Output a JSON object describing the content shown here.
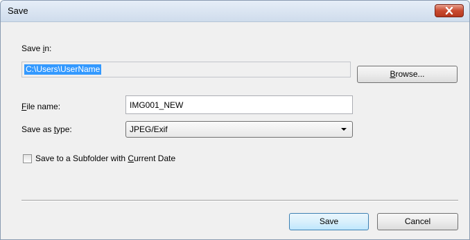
{
  "window": {
    "title": "Save"
  },
  "save_in": {
    "label_pre": "Save ",
    "label_acc": "i",
    "label_post": "n:",
    "path_value": "C:\\Users\\UserName"
  },
  "browse_button": {
    "pre": "",
    "acc": "B",
    "post": "rowse..."
  },
  "file_name": {
    "label_acc": "F",
    "label_post": "ile name:",
    "value": "IMG001_NEW"
  },
  "save_as_type": {
    "label_pre": "Save as ",
    "label_acc": "t",
    "label_post": "ype:",
    "selected": "JPEG/Exif"
  },
  "subfolder_option": {
    "label_pre": "Save to a Subfolder with ",
    "label_acc": "C",
    "label_post": "urrent Date",
    "checked": false
  },
  "buttons": {
    "save": "Save",
    "cancel": "Cancel"
  }
}
